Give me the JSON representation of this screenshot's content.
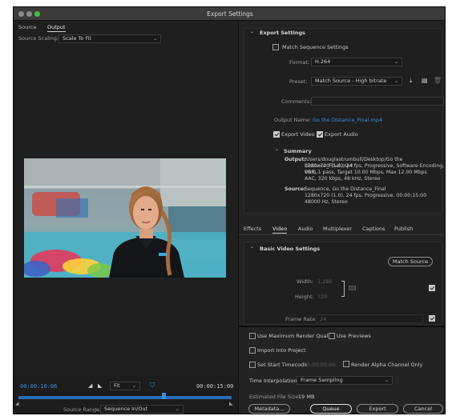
{
  "window": {
    "title": "Export Settings"
  },
  "source_panel": {
    "tab_source": "Source",
    "tab_output": "Output",
    "scaling_label": "Source Scaling:",
    "scaling_value": "Scale To Fit",
    "timecode_current": "00:00:10:06",
    "fit_value": "Fit",
    "timecode_end": "00:00:15:00",
    "source_range_label": "Source Range:",
    "source_range_value": "Sequence In/Out",
    "playhead_progress": 0.68
  },
  "export_settings": {
    "header": "Export Settings",
    "match_sequence": "Match Sequence Settings",
    "match_sequence_checked": false,
    "format_label": "Format:",
    "format_value": "H.264",
    "preset_label": "Preset:",
    "preset_value": "Match Source - High bitrate",
    "comments_label": "Comments:",
    "output_name_label": "Output Name:",
    "output_name_value": "Go the Distance_Final.mp4",
    "export_video": "Export Video",
    "export_video_checked": true,
    "export_audio": "Export Audio",
    "export_audio_checked": true
  },
  "summary": {
    "header": "Summary",
    "output_label": "Output:",
    "output_lines": [
      "/Users/douglastrumbull/Desktop/Go the Distance_Final.mp4",
      "1280x720 (1.0), 24 fps, Progressive, Software Encoding, 00:0...",
      "VBR, 1 pass, Target 10.00 Mbps, Max 12.00 Mbps",
      "AAC, 320 kbps, 48 kHz, Stereo"
    ],
    "source_label": "Source:",
    "source_lines": [
      "Sequence, Go the Distance_Final",
      "1280x720 (1.0), 24 fps, Progressive, 00:00:15:00",
      "48000 Hz, Stereo"
    ]
  },
  "tabs": [
    "Effects",
    "Video",
    "Audio",
    "Multiplexer",
    "Captions",
    "Publish"
  ],
  "active_tab": "Video",
  "video_settings": {
    "header": "Basic Video Settings",
    "match_source_button": "Match Source",
    "width_label": "Width:",
    "width_value": "1,280",
    "height_label": "Height:",
    "height_value": "720",
    "frame_rate_label": "Frame Rate:",
    "frame_rate_value": "24"
  },
  "bottom": {
    "max_render": "Use Maximum Render Quality",
    "use_previews": "Use Previews",
    "import_project": "Import Into Project",
    "set_start_timecode": "Set Start Timecode",
    "start_timecode_value": "00:00:00:00",
    "render_alpha": "Render Alpha Channel Only",
    "time_interp_label": "Time Interpolation:",
    "time_interp_value": "Frame Sampling",
    "file_size_label": "Estimated File Size:",
    "file_size_value": "19 MB",
    "metadata_button": "Metadata...",
    "queue_button": "Queue",
    "export_button": "Export",
    "cancel_button": "Cancel"
  },
  "colors": {
    "accent_blue": "#3d8fe0",
    "panel": "#232323",
    "window_bg": "#1f1f1f"
  }
}
